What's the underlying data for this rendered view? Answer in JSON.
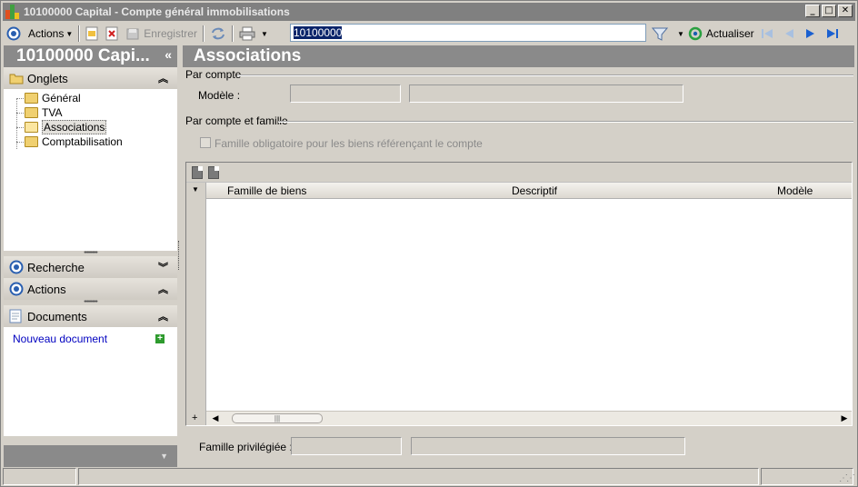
{
  "window": {
    "title": "10100000 Capital - Compte général immobilisations",
    "buttons": {
      "minimize": "_",
      "maximize": "□",
      "close": "✕"
    }
  },
  "toolbar": {
    "actions_label": "Actions",
    "save_label": "Enregistrer",
    "search_value": "10100000",
    "refresh_label": "Actualiser"
  },
  "left_panel": {
    "header": "10100000 Capi...",
    "collapse_glyph": "«",
    "sections": {
      "onglets": "Onglets",
      "recherche": "Recherche",
      "actions": "Actions",
      "documents": "Documents"
    },
    "tree_items": [
      "Général",
      "TVA",
      "Associations",
      "Comptabilisation"
    ],
    "selected_item": "Associations",
    "new_document_link": "Nouveau document"
  },
  "main": {
    "header": "Associations",
    "group_par_compte": "Par compte",
    "modele_label": "Modèle :",
    "group_par_compte_famille": "Par compte et famille",
    "checkbox_label": "Famille obligatoire pour les biens référençant le compte",
    "grid": {
      "columns": [
        "Famille de biens",
        "Descriptif",
        "Modèle"
      ]
    },
    "famille_privilegiee_label": "Famille privilégiée :"
  }
}
